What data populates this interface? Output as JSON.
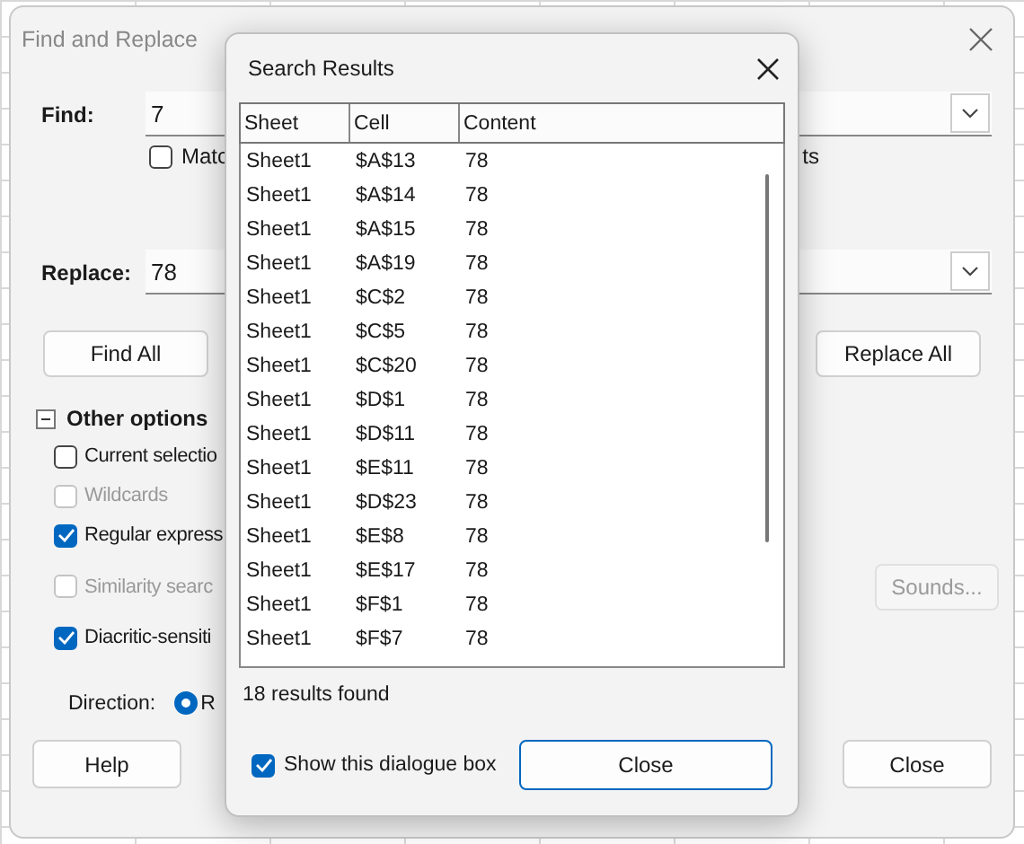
{
  "find_replace": {
    "title": "Find and Replace",
    "find": {
      "label": "Find:",
      "value": "7"
    },
    "match_option": {
      "label": "Matc",
      "checked": false
    },
    "hidden_option_tail": "ts",
    "replace": {
      "label": "Replace:",
      "value": "78"
    },
    "find_all": "Find All",
    "replace_all": "Replace All",
    "other_options": {
      "label": "Other options",
      "expanded": true,
      "checkboxes": [
        {
          "label": "Current selectio",
          "checked": false,
          "disabled": false
        },
        {
          "label": "Wildcards",
          "checked": false,
          "disabled": true
        },
        {
          "label": "Regular express",
          "checked": true,
          "disabled": false
        },
        {
          "label": "Similarity searc",
          "checked": false,
          "disabled": true
        },
        {
          "label": "Diacritic-sensiti",
          "checked": true,
          "disabled": false
        }
      ]
    },
    "sounds_button": {
      "label": "Sounds...",
      "disabled": true
    },
    "direction": {
      "label": "Direction:",
      "option": {
        "label": "R",
        "selected": true
      }
    },
    "help": "Help",
    "close": "Close"
  },
  "search_results": {
    "title": "Search Results",
    "columns": [
      "Sheet",
      "Cell",
      "Content"
    ],
    "rows": [
      [
        "Sheet1",
        "$A$13",
        "78"
      ],
      [
        "Sheet1",
        "$A$14",
        "78"
      ],
      [
        "Sheet1",
        "$A$15",
        "78"
      ],
      [
        "Sheet1",
        "$A$19",
        "78"
      ],
      [
        "Sheet1",
        "$C$2",
        "78"
      ],
      [
        "Sheet1",
        "$C$5",
        "78"
      ],
      [
        "Sheet1",
        "$C$20",
        "78"
      ],
      [
        "Sheet1",
        "$D$1",
        "78"
      ],
      [
        "Sheet1",
        "$D$11",
        "78"
      ],
      [
        "Sheet1",
        "$E$11",
        "78"
      ],
      [
        "Sheet1",
        "$D$23",
        "78"
      ],
      [
        "Sheet1",
        "$E$8",
        "78"
      ],
      [
        "Sheet1",
        "$E$17",
        "78"
      ],
      [
        "Sheet1",
        "$F$1",
        "78"
      ],
      [
        "Sheet1",
        "$F$7",
        "78"
      ]
    ],
    "count": "18 results found",
    "show_again": {
      "label": "Show this dialogue box",
      "checked": true
    },
    "close": "Close"
  }
}
